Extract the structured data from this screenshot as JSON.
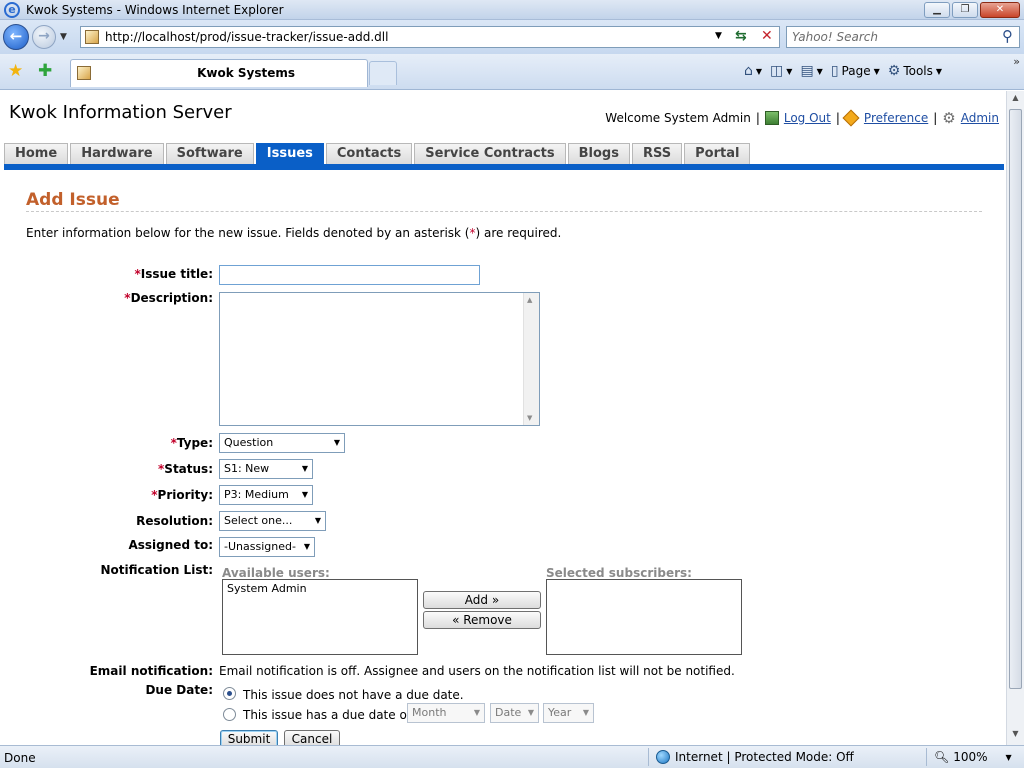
{
  "window": {
    "title": "Kwok Systems - Windows Internet Explorer"
  },
  "browser": {
    "url": "http://localhost/prod/issue-tracker/issue-add.dll",
    "search_placeholder": "Yahoo! Search",
    "tab_title": "Kwok Systems",
    "cmd_page": "Page",
    "cmd_tools": "Tools"
  },
  "site": {
    "title": "Kwok Information Server",
    "welcome": "Welcome System Admin",
    "logout": "Log Out",
    "preference": "Preference",
    "admin": "Admin"
  },
  "nav": {
    "tabs": [
      "Home",
      "Hardware",
      "Software",
      "Issues",
      "Contacts",
      "Service Contracts",
      "Blogs",
      "RSS",
      "Portal"
    ],
    "active": "Issues"
  },
  "form": {
    "heading": "Add Issue",
    "intro_prefix": "Enter information below for the new issue. Fields denoted by an asterisk (",
    "intro_ast": "*",
    "intro_suffix": ") are required.",
    "asterisk": "*",
    "issue_title_label": "Issue title:",
    "description_label": "Description:",
    "type_label": "Type:",
    "type_value": "Question",
    "status_label": "Status:",
    "status_value": "S1: New",
    "priority_label": "Priority:",
    "priority_value": "P3: Medium",
    "resolution_label": "Resolution:",
    "resolution_value": "Select one...",
    "assigned_label": "Assigned to:",
    "assigned_value": "-Unassigned-",
    "notification_label": "Notification List:",
    "available_users_label": "Available users:",
    "available_users": [
      "System Admin"
    ],
    "selected_subscribers_label": "Selected subscribers:",
    "add_button": "Add »",
    "remove_button": "« Remove",
    "email_label": "Email notification:",
    "email_text": "Email notification is off. Assignee and users on the notification list will not be notified.",
    "due_label": "Due Date:",
    "due_option_none": "This issue does not have a due date.",
    "due_option_date": "This issue has a due date of",
    "month_placeholder": "Month",
    "date_placeholder": "Date",
    "year_placeholder": "Year",
    "submit": "Submit",
    "cancel": "Cancel"
  },
  "status": {
    "left": "Done",
    "zone": "Internet | Protected Mode: Off",
    "zoom": "100%"
  }
}
